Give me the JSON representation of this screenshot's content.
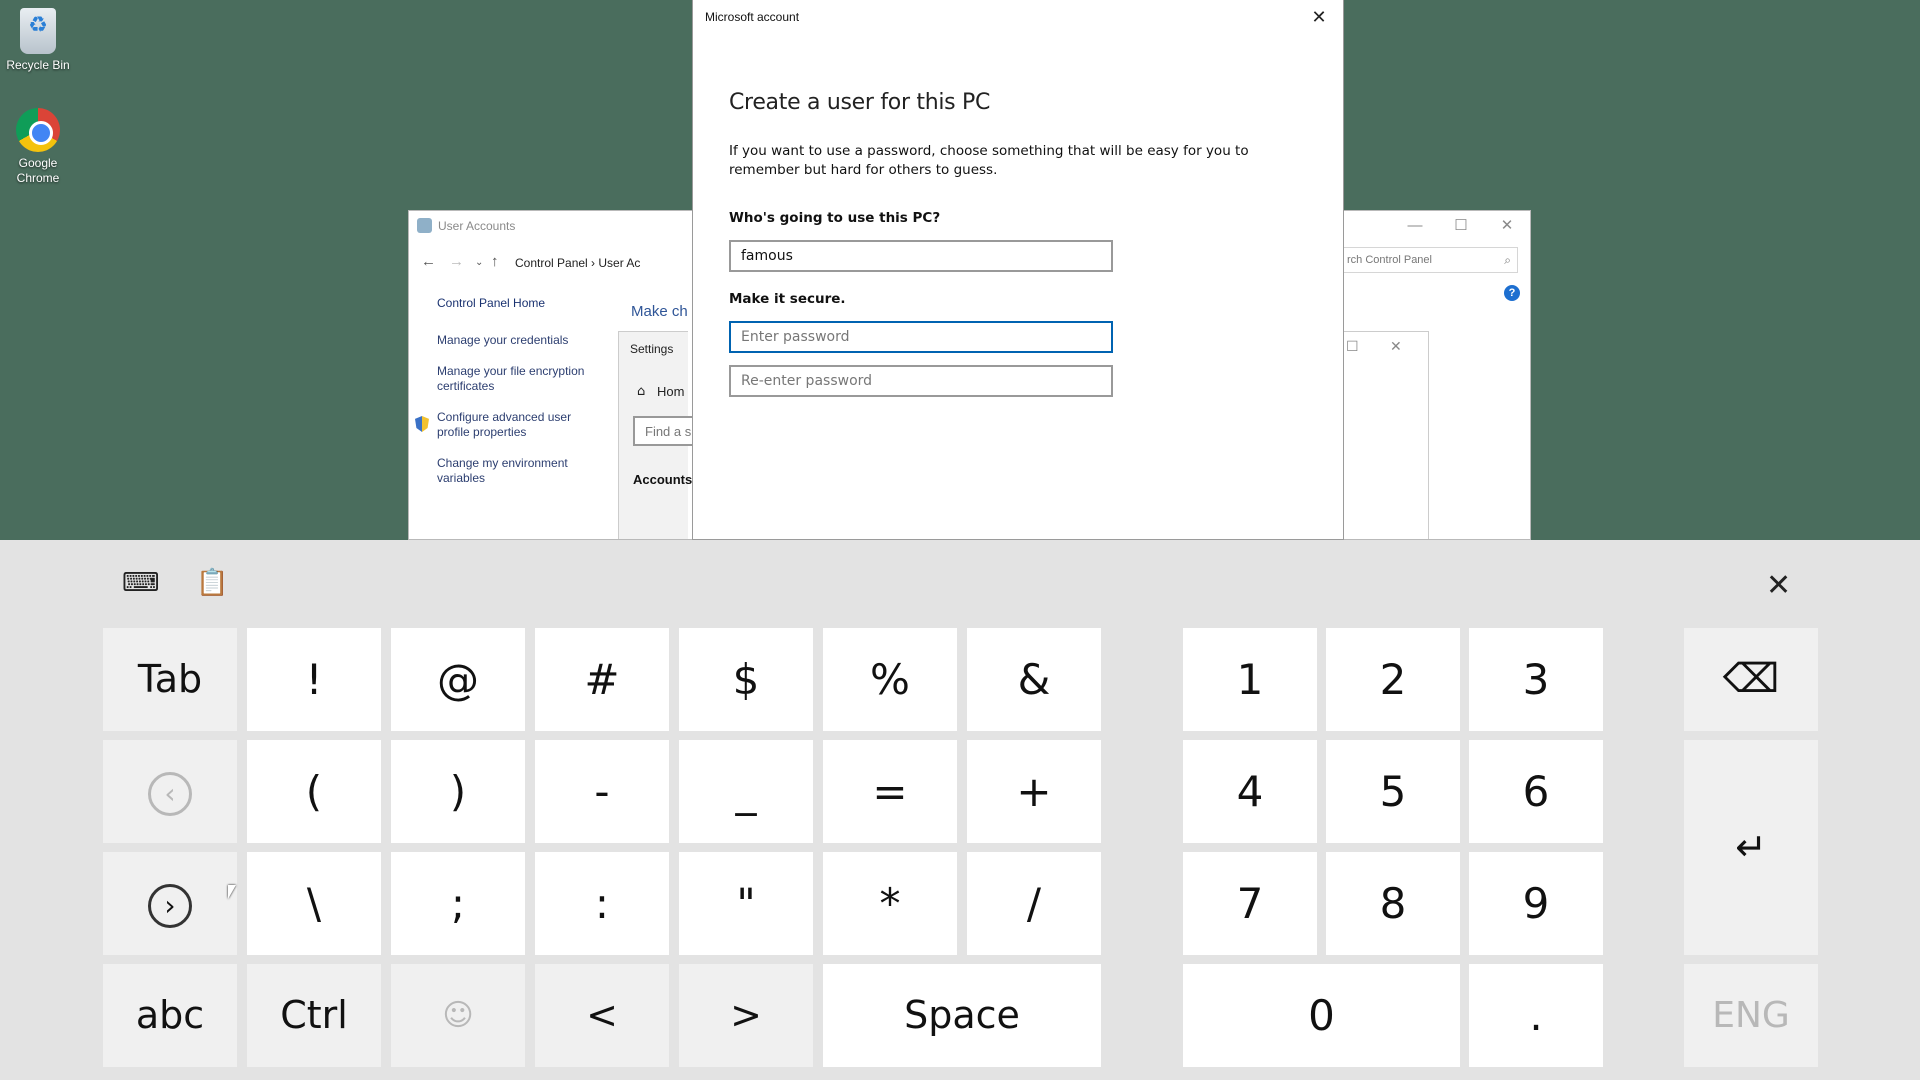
{
  "desktop": {
    "icons": [
      {
        "label": "Recycle Bin",
        "icon": "recycle-bin-icon"
      },
      {
        "label": "Google Chrome",
        "icon": "chrome-icon"
      }
    ]
  },
  "user_accounts": {
    "title": "User Accounts",
    "breadcrumb": "Control Panel  ›  User Ac",
    "search_placeholder": "rch Control Panel",
    "sidebar": {
      "home": "Control Panel Home",
      "items": [
        "Manage your credentials",
        "Manage your file encryption certificates",
        "Configure advanced user profile properties",
        "Change my environment variables"
      ]
    },
    "main_heading": "Make ch",
    "settings_pane": {
      "label": "Settings",
      "home": "Hom",
      "find_placeholder": "Find a s",
      "accounts": "Accounts"
    }
  },
  "ms_dialog": {
    "title": "Microsoft account",
    "heading": "Create a user for this PC",
    "description": "If you want to use a password, choose something that will be easy for you to remember but hard for others to guess.",
    "who_label": "Who's going to use this PC?",
    "username_value": "famous",
    "secure_label": "Make it secure.",
    "password_placeholder": "Enter password",
    "reenter_placeholder": "Re-enter password"
  },
  "keyboard": {
    "rows": [
      [
        "Tab",
        "!",
        "@",
        "#",
        "$",
        "%",
        "&"
      ],
      [
        "(",
        ")",
        "-",
        "_",
        "=",
        "+"
      ],
      [
        "\\",
        ";",
        ":",
        "\"",
        "*",
        "/"
      ],
      [
        "abc",
        "Ctrl",
        "<",
        ">",
        "Space"
      ]
    ],
    "numpad": [
      "1",
      "2",
      "3",
      "4",
      "5",
      "6",
      "7",
      "8",
      "9",
      "0",
      "."
    ],
    "language": "ENG"
  }
}
